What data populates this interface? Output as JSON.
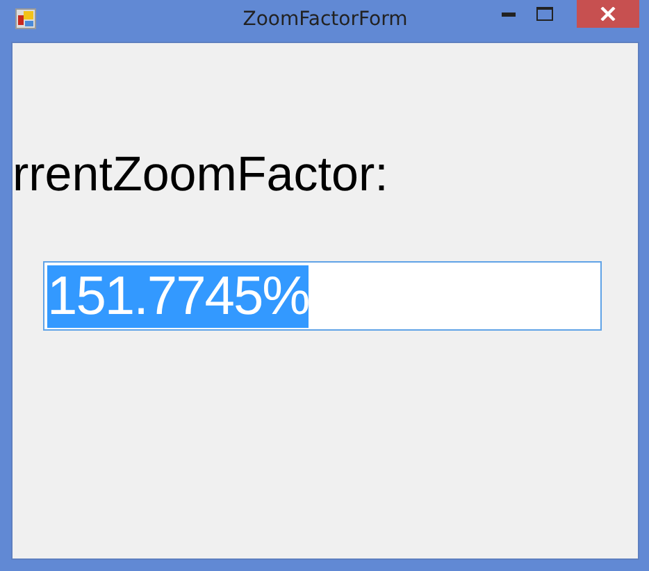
{
  "window": {
    "title": "ZoomFactorForm"
  },
  "label": "rrentZoomFactor:",
  "field": {
    "value": "151.7745%",
    "text_selected": true
  }
}
